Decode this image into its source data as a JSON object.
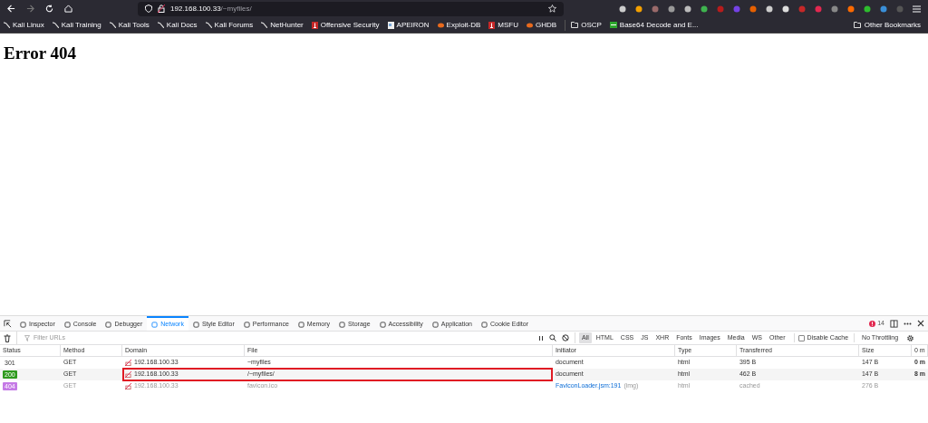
{
  "toolbar": {
    "url_host": "192.168.100.33",
    "url_path": "/~myfiles/"
  },
  "bookmarks": [
    {
      "label": "Kali Linux",
      "kind": "kali"
    },
    {
      "label": "Kali Training",
      "kind": "kali"
    },
    {
      "label": "Kali Tools",
      "kind": "kali"
    },
    {
      "label": "Kali Docs",
      "kind": "kali"
    },
    {
      "label": "Kali Forums",
      "kind": "kali"
    },
    {
      "label": "NetHunter",
      "kind": "kali"
    },
    {
      "label": "Offensive Security",
      "kind": "red"
    },
    {
      "label": "APEIRON",
      "kind": "page"
    },
    {
      "label": "Exploit-DB",
      "kind": "orange"
    },
    {
      "label": "MSFU",
      "kind": "red"
    },
    {
      "label": "GHDB",
      "kind": "orange"
    },
    {
      "label": "OSCP",
      "kind": "folder"
    },
    {
      "label": "Base64 Decode and E...",
      "kind": "green"
    }
  ],
  "other_bookmarks": "Other Bookmarks",
  "page": {
    "heading": "Error 404"
  },
  "devtools": {
    "tabs": [
      {
        "label": "Inspector",
        "selected": false
      },
      {
        "label": "Console",
        "selected": false
      },
      {
        "label": "Debugger",
        "selected": false
      },
      {
        "label": "Network",
        "selected": true
      },
      {
        "label": "Style Editor",
        "selected": false
      },
      {
        "label": "Performance",
        "selected": false
      },
      {
        "label": "Memory",
        "selected": false
      },
      {
        "label": "Storage",
        "selected": false
      },
      {
        "label": "Accessibility",
        "selected": false
      },
      {
        "label": "Application",
        "selected": false
      },
      {
        "label": "Cookie Editor",
        "selected": false
      }
    ],
    "error_count": "14",
    "filter": {
      "placeholder": "Filter URLs"
    },
    "type_filters": [
      {
        "label": "All",
        "selected": true
      },
      {
        "label": "HTML",
        "selected": false
      },
      {
        "label": "CSS",
        "selected": false
      },
      {
        "label": "JS",
        "selected": false
      },
      {
        "label": "XHR",
        "selected": false
      },
      {
        "label": "Fonts",
        "selected": false
      },
      {
        "label": "Images",
        "selected": false
      },
      {
        "label": "Media",
        "selected": false
      },
      {
        "label": "WS",
        "selected": false
      },
      {
        "label": "Other",
        "selected": false
      }
    ],
    "disable_cache": {
      "label": "Disable Cache",
      "checked": false
    },
    "throttling": "No Throttling",
    "table": {
      "columns": [
        "Status",
        "Method",
        "Domain",
        "File",
        "Initiator",
        "Type",
        "Transferred",
        "Size",
        "0 m"
      ],
      "rows": [
        {
          "status": "301",
          "method": "GET",
          "domain": "192.168.100.33",
          "file": "~myfiles",
          "initiator": "document",
          "type": "html",
          "transferred": "395 B",
          "size": "147 B",
          "timing": "0 m",
          "highlighted": false,
          "dimmed": false
        },
        {
          "status": "200",
          "color": "#2f9a1e",
          "method": "GET",
          "domain": "192.168.100.33",
          "file": "/~myfiles/",
          "initiator": "document",
          "type": "html",
          "transferred": "462 B",
          "size": "147 B",
          "timing": "8 m",
          "highlighted": true,
          "dimmed": false
        },
        {
          "status": "404",
          "color": "#c57ae6",
          "method": "GET",
          "domain": "192.168.100.33",
          "file": "favicon.ico",
          "initiator": "FaviconLoader.jsm:191",
          "initiator_note": "(img)",
          "type": "html",
          "transferred": "cached",
          "size": "276 B",
          "highlighted": false,
          "dimmed": true
        }
      ]
    }
  }
}
